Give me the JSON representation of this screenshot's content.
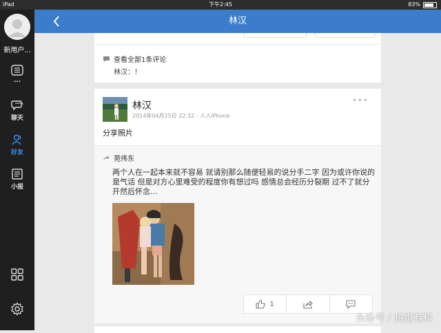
{
  "status_bar": {
    "device": "iPad",
    "time": "下午2:45",
    "battery": "83%"
  },
  "sidebar": {
    "username": "新用户...",
    "items": [
      {
        "label": "...",
        "icon": "list-icon"
      },
      {
        "label": "聊天",
        "icon": "chat-icon"
      },
      {
        "label": "好友",
        "icon": "friends-icon",
        "active": true
      },
      {
        "label": "小报",
        "icon": "news-icon"
      }
    ],
    "bottom_icons": [
      "apps-grid-icon",
      "settings-icon"
    ]
  },
  "header": {
    "title": "林汉"
  },
  "first_card": {
    "view_all_comments": "查看全部1条评论",
    "comment": "林汉：！"
  },
  "post": {
    "author": "林汉",
    "meta": "2014年04月25日 22:32 - 人人iPhone",
    "text": "分享照片",
    "shared": {
      "author": "苑伟东",
      "text": "两个人在一起本来就不容易 就请别那么随便轻易的说分手二字 因为或许你说的是气话 但是对方心里难受的程度你有想过吗 感情总会经历分裂期 过不了就分开然后怀念..."
    },
    "actions": {
      "like_count": "1"
    }
  },
  "watermark": "头条号 / 热姐有料",
  "colors": {
    "accent": "#3b7dcb",
    "sidebar_bg": "#1f1f1f",
    "active_nav": "#3d8cf0"
  }
}
